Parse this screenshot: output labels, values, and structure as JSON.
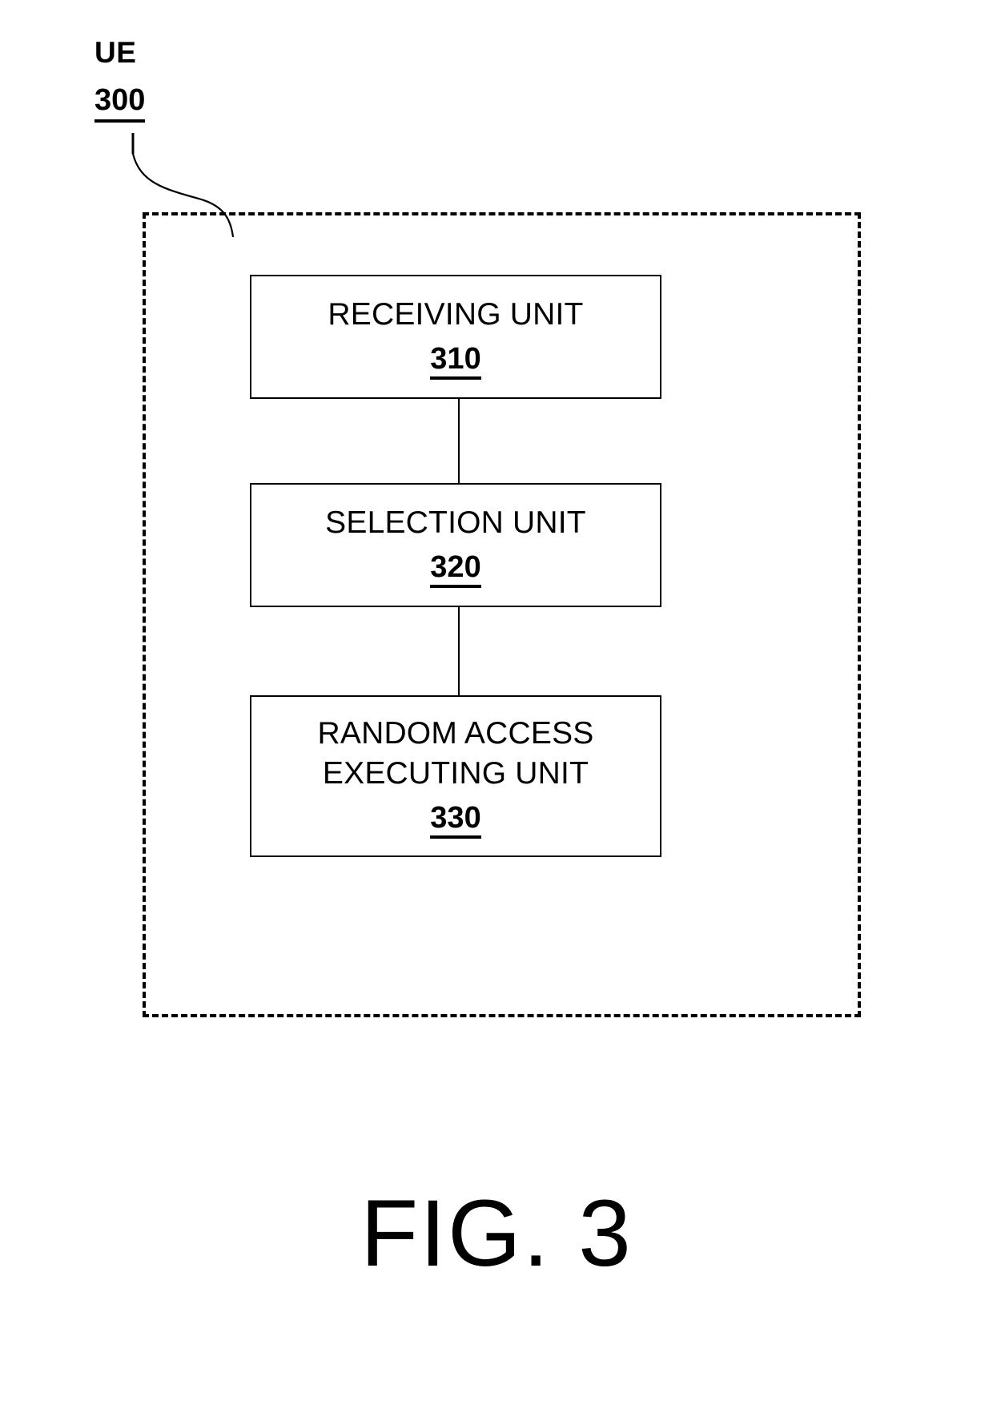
{
  "figure": {
    "caption": "FIG. 3",
    "reference_label": {
      "name": "UE",
      "number": "300"
    },
    "container": {
      "style": "dashed",
      "semantic": "ue-boundary"
    },
    "units": [
      {
        "title": "RECEIVING UNIT",
        "number": "310",
        "name": "receiving-unit"
      },
      {
        "title": "SELECTION UNIT",
        "number": "320",
        "name": "selection-unit"
      },
      {
        "title": "RANDOM ACCESS\nEXECUTING UNIT",
        "number": "330",
        "name": "random-access-executing-unit"
      }
    ],
    "connectors": [
      {
        "from": "310",
        "to": "320"
      },
      {
        "from": "320",
        "to": "330"
      }
    ],
    "colors": {
      "line": "#000000",
      "background": "#ffffff"
    }
  }
}
